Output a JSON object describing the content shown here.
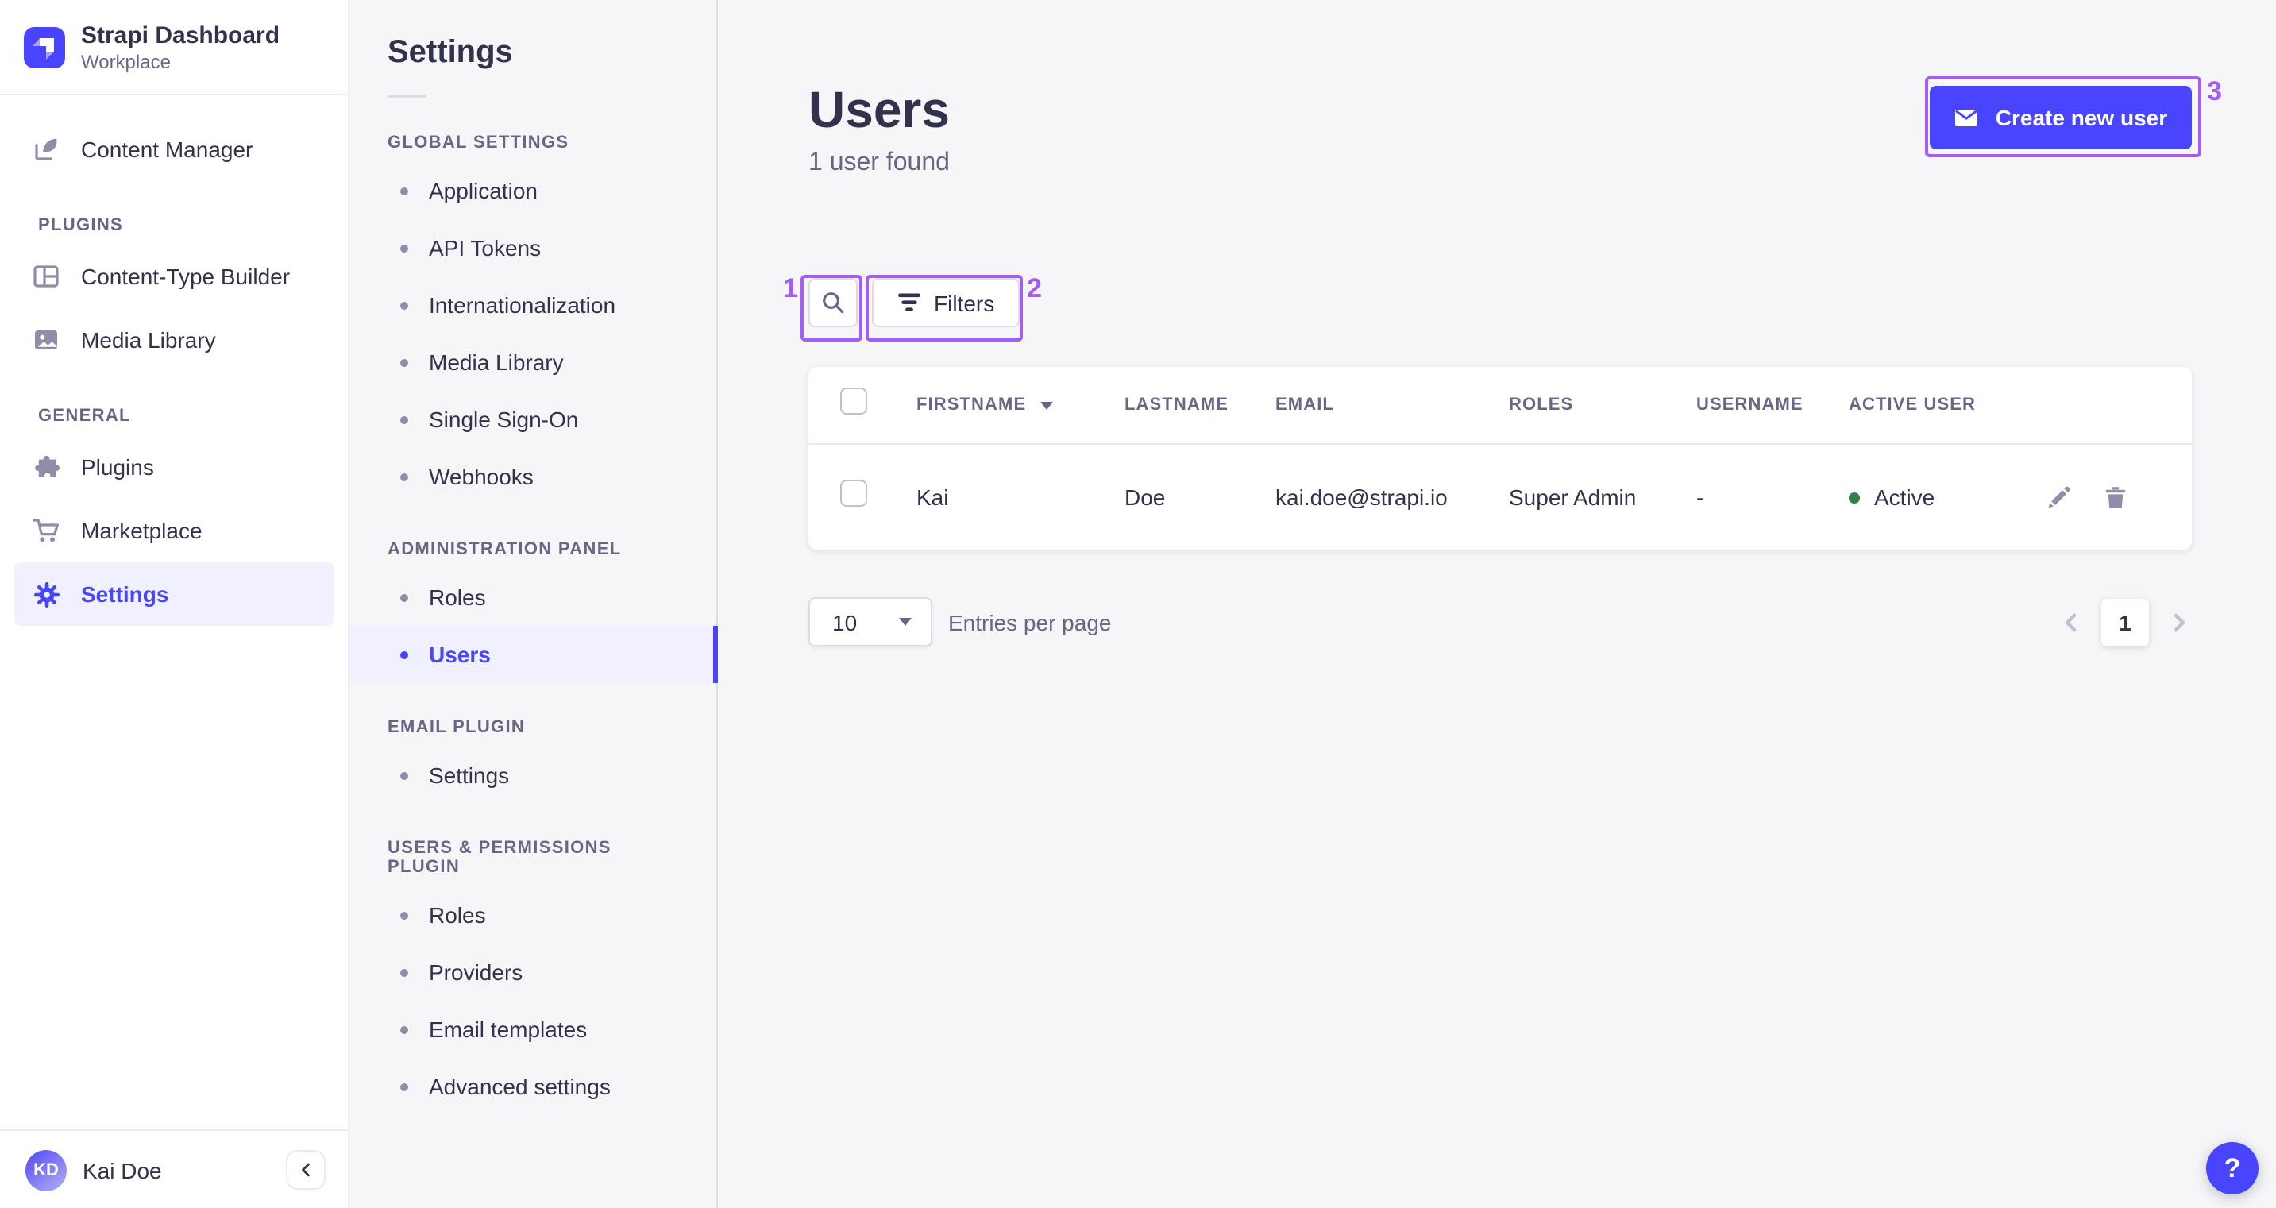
{
  "brand": {
    "name": "Strapi Dashboard",
    "workspace": "Workplace"
  },
  "sidebar": {
    "content_manager": "Content Manager",
    "sections": [
      {
        "label": "PLUGINS",
        "items": [
          {
            "label": "Content-Type Builder"
          },
          {
            "label": "Media Library"
          }
        ]
      },
      {
        "label": "GENERAL",
        "items": [
          {
            "label": "Plugins"
          },
          {
            "label": "Marketplace"
          },
          {
            "label": "Settings"
          }
        ]
      }
    ],
    "user": {
      "initials": "KD",
      "name": "Kai Doe"
    }
  },
  "settings_nav": {
    "title": "Settings",
    "sections": [
      {
        "label": "GLOBAL SETTINGS",
        "items": [
          "Application",
          "API Tokens",
          "Internationalization",
          "Media Library",
          "Single Sign-On",
          "Webhooks"
        ]
      },
      {
        "label": "ADMINISTRATION PANEL",
        "items": [
          "Roles",
          "Users"
        ],
        "selected_item": "Users"
      },
      {
        "label": "EMAIL PLUGIN",
        "items": [
          "Settings"
        ]
      },
      {
        "label": "USERS & PERMISSIONS PLUGIN",
        "items": [
          "Roles",
          "Providers",
          "Email templates",
          "Advanced settings"
        ]
      }
    ]
  },
  "main": {
    "title": "Users",
    "subtitle": "1 user found",
    "create_button": "Create new user",
    "filters_button": "Filters",
    "table": {
      "columns": [
        "FIRSTNAME",
        "LASTNAME",
        "EMAIL",
        "ROLES",
        "USERNAME",
        "ACTIVE USER"
      ],
      "rows": [
        {
          "firstname": "Kai",
          "lastname": "Doe",
          "email": "kai.doe@strapi.io",
          "roles": "Super Admin",
          "username": "-",
          "active": "Active"
        }
      ]
    },
    "pagination": {
      "page_size": "10",
      "entries_label": "Entries per page",
      "page": "1"
    },
    "help": "?"
  },
  "annotations": {
    "marks": [
      "1",
      "2",
      "3"
    ],
    "color": "#a35cf5"
  },
  "colors": {
    "primary": "#4945ff",
    "selected_bg": "#f0f0ff",
    "success": "#328048",
    "muted": "#666687"
  }
}
